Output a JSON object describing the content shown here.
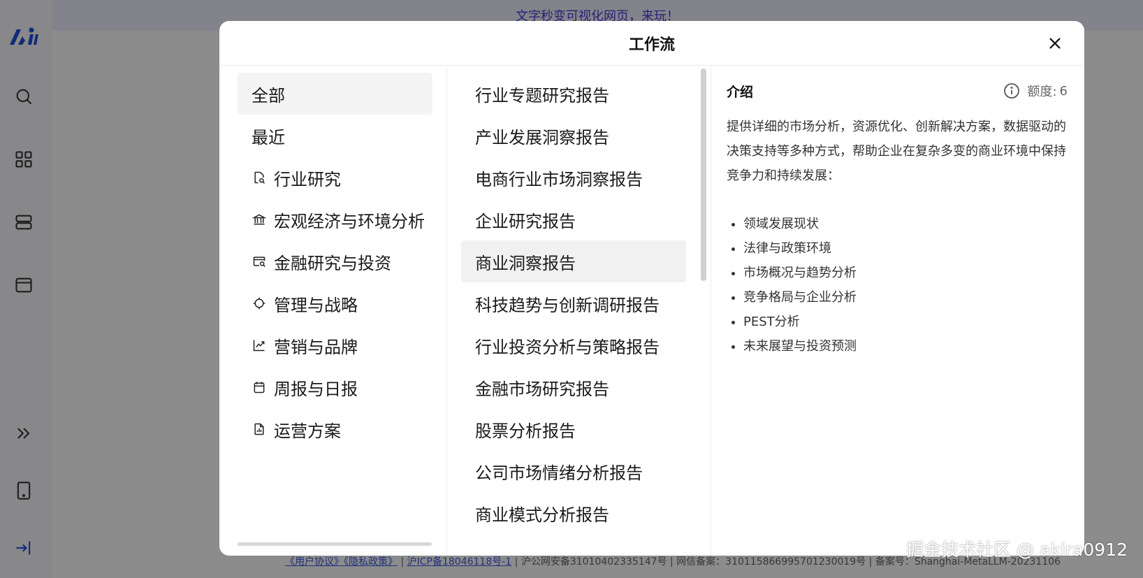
{
  "banner": {
    "text": "文字秒变可视化网页，来玩！"
  },
  "sidebar": {
    "icons": [
      "logo-icon",
      "search-icon",
      "grid-icon",
      "stack-icon",
      "card-icon",
      "expand-icon",
      "tablet-icon",
      "login-icon"
    ]
  },
  "footer": {
    "link_agreement": "《用户协议》",
    "link_privacy": "《隐私政策》",
    "icp": "沪ICP备18046118号-1",
    "police": "沪公网安备31010402335147号",
    "info": "网信备案：310115866995701230019号 | 备案号：Shanghai-MetaLLM-20231106"
  },
  "watermark": "掘金技术社区 @ akira0912",
  "modal": {
    "title": "工作流",
    "categories": [
      {
        "label": "全部",
        "icon": ""
      },
      {
        "label": "最近",
        "icon": ""
      },
      {
        "label": "行业研究",
        "icon": "doc-search-icon"
      },
      {
        "label": "宏观经济与环境分析",
        "icon": "bank-icon"
      },
      {
        "label": "金融研究与投资",
        "icon": "card-search-icon"
      },
      {
        "label": "管理与战略",
        "icon": "crosshair-icon"
      },
      {
        "label": "营销与品牌",
        "icon": "trend-chart-icon"
      },
      {
        "label": "周报与日报",
        "icon": "calendar-icon"
      },
      {
        "label": "运营方案",
        "icon": "doc-chart-icon"
      }
    ],
    "workflows": [
      "行业专题研究报告",
      "产业发展洞察报告",
      "电商行业市场洞察报告",
      "企业研究报告",
      "商业洞察报告",
      "科技趋势与创新调研报告",
      "行业投资分析与策略报告",
      "金融市场研究报告",
      "股票分析报告",
      "公司市场情绪分析报告",
      "商业模式分析报告"
    ],
    "intro": {
      "title": "介绍",
      "quota_label": "额度:",
      "quota_value": "6",
      "description": "提供详细的市场分析，资源优化、创新解决方案，数据驱动的决策支持等多种方式，帮助企业在复杂多变的商业环境中保持竞争力和持续发展：",
      "features": [
        "领域发展现状",
        "法律与政策环境",
        "市场概况与趋势分析",
        "竞争格局与企业分析",
        "PEST分析",
        "未来展望与投资预测"
      ]
    }
  }
}
